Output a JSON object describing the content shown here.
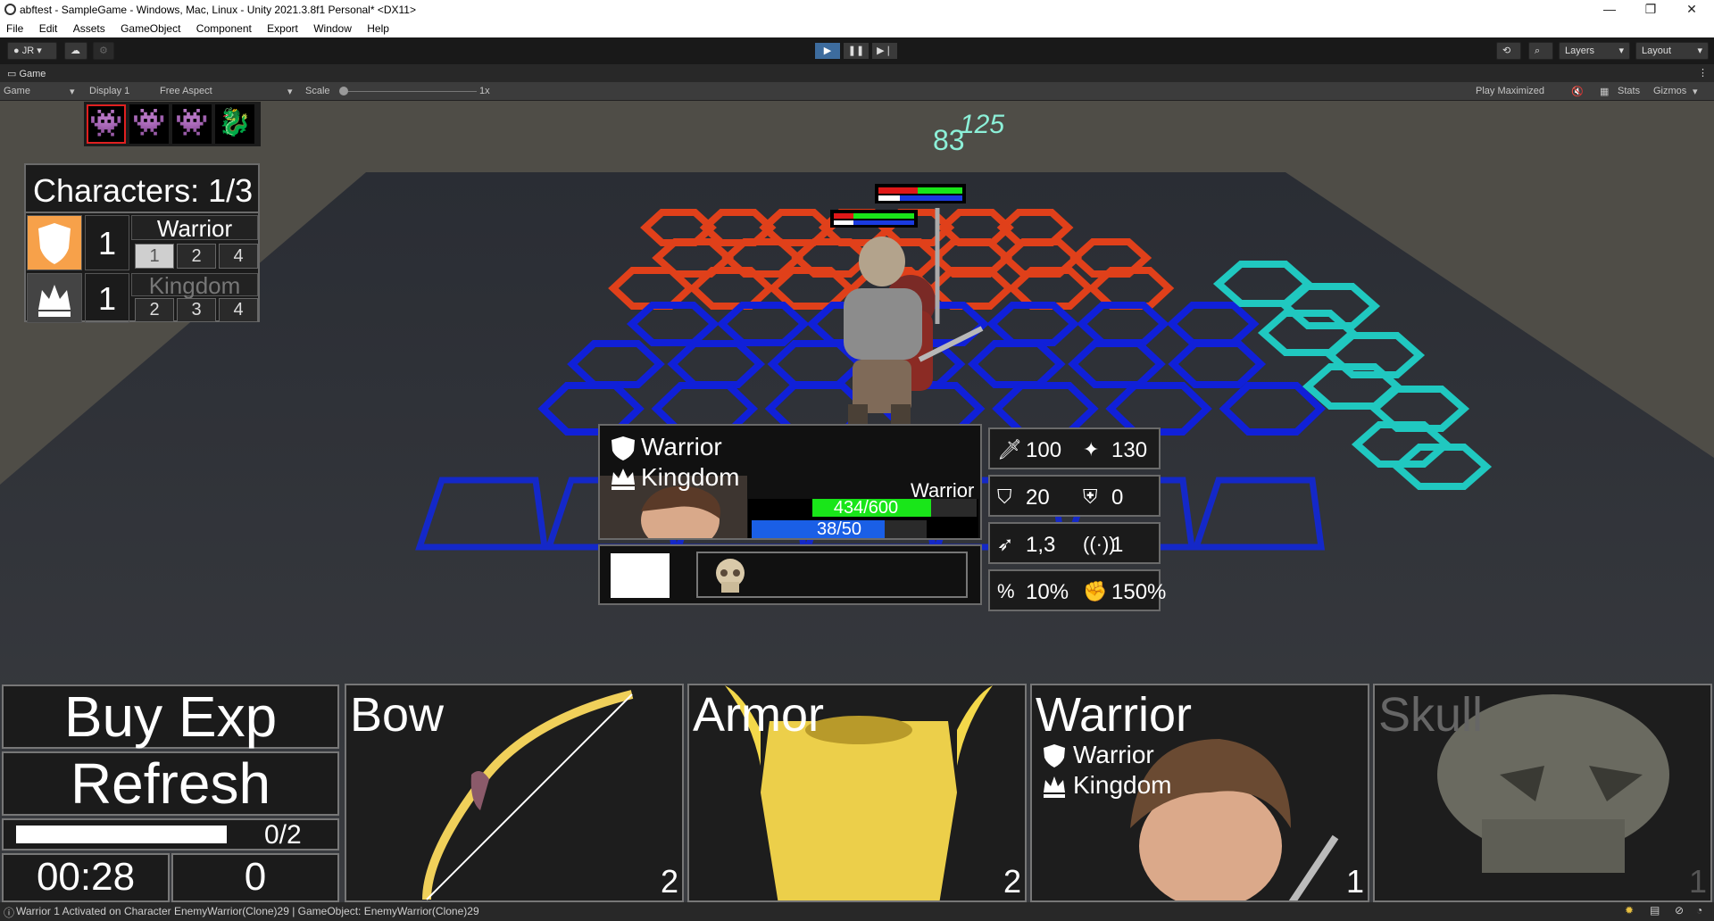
{
  "window": {
    "title": "abftest - SampleGame - Windows, Mac, Linux - Unity 2021.3.8f1 Personal* <DX11>"
  },
  "menu": [
    "File",
    "Edit",
    "Assets",
    "GameObject",
    "Component",
    "Export",
    "Window",
    "Help"
  ],
  "toolbar": {
    "account": "JR",
    "layers": "Layers",
    "layout": "Layout"
  },
  "game_tab": {
    "label": "Game"
  },
  "game_bar": {
    "view": "Game",
    "display": "Display 1",
    "aspect": "Free Aspect",
    "scale_label": "Scale",
    "scale_value": "1x",
    "play_mode": "Play Maximized",
    "stats": "Stats",
    "gizmos": "Gizmos"
  },
  "hud": {
    "characters_title": "Characters: 1/3",
    "synergies": [
      {
        "count": "1",
        "name": "Warrior",
        "tiers": [
          "1",
          "2",
          "4"
        ]
      },
      {
        "count": "1",
        "name": "Kingdom",
        "tiers": [
          "2",
          "3",
          "4"
        ]
      }
    ],
    "damage_numbers": [
      "83",
      "125"
    ]
  },
  "unit_panel": {
    "traits": [
      "Warrior",
      "Kingdom"
    ],
    "unit_name": "Warrior",
    "hp_text": "434/600",
    "hp_fraction": 0.723,
    "mana_text": "38/50",
    "mana_fraction": 0.76
  },
  "stats": [
    {
      "a": "100",
      "b": "130",
      "icon_a": "sword-icon",
      "icon_b": "sparkle-icon"
    },
    {
      "a": "20",
      "b": "0",
      "icon_a": "shield-icon",
      "icon_b": "magic-shield-icon"
    },
    {
      "a": "1,3",
      "b": "1",
      "icon_a": "bow-icon",
      "icon_b": "range-icon"
    },
    {
      "a": "10%",
      "b": "150%",
      "icon_a": "percent-icon",
      "icon_b": "crit-icon"
    }
  ],
  "shop": {
    "buy_exp": "Buy Exp",
    "refresh": "Refresh",
    "exp_text": "0/2",
    "timer": "00:28",
    "gold": "0",
    "cards": [
      {
        "name": "Bow",
        "cost": "2"
      },
      {
        "name": "Armor",
        "cost": "2"
      },
      {
        "name": "Warrior",
        "cost": "1",
        "traits": [
          "Warrior",
          "Kingdom"
        ]
      },
      {
        "name": "Skull",
        "cost": "1"
      }
    ]
  },
  "status": {
    "message": "Warrior 1 Activated on Character EnemyWarrior(Clone)29 | GameObject: EnemyWarrior(Clone)29"
  },
  "colors": {
    "hp": "#19e619",
    "mana": "#1a5fe6",
    "enemy_hex": "#e0401a",
    "ally_hex": "#1020d8",
    "bench_hex": "#20c8c0"
  }
}
